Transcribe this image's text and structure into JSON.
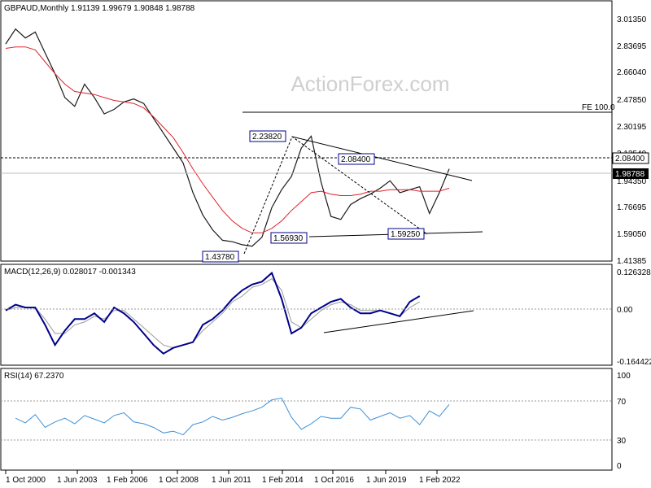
{
  "chart_data": [
    {
      "panel": "price",
      "type": "line",
      "title": "GBPAUD,Monthly 1.91139 1.99679 1.90848 1.98788",
      "watermark": "ActionForex.com",
      "symbol": "GBPAUD",
      "timeframe": "Monthly",
      "ohlc_last": {
        "open": 1.91139,
        "high": 1.99679,
        "low": 1.90848,
        "close": 1.98788
      },
      "current_price_label": "1.98788",
      "ylim": [
        1.36,
        3.11
      ],
      "y_ticks": [
        "3.01350",
        "2.83695",
        "2.66040",
        "2.47850",
        "2.30195",
        "2.12540",
        "1.94350",
        "1.76695",
        "1.59050",
        "1.41385"
      ],
      "x": [
        "2000-10",
        "2001-04",
        "2001-10",
        "2002-04",
        "2002-10",
        "2003-04",
        "2003-10",
        "2004-04",
        "2004-10",
        "2005-04",
        "2005-10",
        "2006-04",
        "2006-10",
        "2007-04",
        "2007-10",
        "2008-04",
        "2008-10",
        "2009-04",
        "2009-10",
        "2010-04",
        "2010-10",
        "2011-04",
        "2011-10",
        "2012-04",
        "2012-10",
        "2013-04",
        "2013-10",
        "2014-04",
        "2014-10",
        "2015-04",
        "2015-10",
        "2016-04",
        "2016-10",
        "2017-04",
        "2017-10",
        "2018-04",
        "2018-10",
        "2019-04",
        "2019-10",
        "2020-04",
        "2020-10",
        "2021-04",
        "2021-10",
        "2022-04",
        "2022-10",
        "2023-04"
      ],
      "series": [
        {
          "values": [
            2.82,
            2.92,
            2.86,
            2.9,
            2.76,
            2.62,
            2.46,
            2.4,
            2.55,
            2.46,
            2.35,
            2.38,
            2.43,
            2.45,
            2.42,
            2.32,
            2.22,
            2.12,
            2.02,
            1.82,
            1.67,
            1.57,
            1.5,
            1.49,
            1.47,
            1.46,
            1.52,
            1.72,
            1.84,
            1.93,
            2.12,
            2.2,
            1.89,
            1.66,
            1.64,
            1.74,
            1.78,
            1.81,
            1.85,
            1.9,
            1.82,
            1.84,
            1.86,
            1.68,
            1.82,
            1.98
          ]
        },
        {
          "name": "MA",
          "values": [
            2.79,
            2.8,
            2.8,
            2.78,
            2.7,
            2.62,
            2.55,
            2.5,
            2.49,
            2.48,
            2.46,
            2.44,
            2.43,
            2.42,
            2.39,
            2.33,
            2.26,
            2.19,
            2.09,
            1.98,
            1.88,
            1.79,
            1.7,
            1.63,
            1.58,
            1.55,
            1.55,
            1.58,
            1.63,
            1.7,
            1.76,
            1.82,
            1.83,
            1.81,
            1.8,
            1.8,
            1.81,
            1.83,
            1.83,
            1.84,
            1.84,
            1.84,
            1.83,
            1.83,
            1.83,
            1.85
          ]
        }
      ],
      "annotations": [
        "2.23820",
        "2.08400",
        "1.56930",
        "1.59250",
        "1.43780",
        "FE 100.0",
        "2.08400"
      ],
      "pivots": [
        {
          "label": "1.43780",
          "x": "2011-06",
          "y": 1.4378
        },
        {
          "label": "2.23820",
          "x": "2014-01",
          "y": 2.2382
        },
        {
          "label": "1.56930",
          "x": "2016-10",
          "y": 1.5693
        },
        {
          "label": "2.08400",
          "x": "2018-06",
          "y": 2.084
        },
        {
          "label": "1.59250",
          "x": "2022-09",
          "y": 1.5925
        }
      ],
      "fe_level": {
        "label": "FE 100.0",
        "y": 2.4
      }
    },
    {
      "panel": "macd",
      "type": "line",
      "title": "MACD(12,26,9) 0.028017 -0.001343",
      "ylim": [
        -0.2,
        0.15
      ],
      "y_ticks": [
        "0.126328",
        "0.00",
        "-0.164422"
      ],
      "x": [
        "2000-10",
        "2001-04",
        "2001-10",
        "2002-04",
        "2002-10",
        "2003-04",
        "2003-10",
        "2004-04",
        "2004-10",
        "2005-04",
        "2005-10",
        "2006-04",
        "2006-10",
        "2007-04",
        "2007-10",
        "2008-04",
        "2008-10",
        "2009-04",
        "2009-10",
        "2010-04",
        "2010-10",
        "2011-04",
        "2011-10",
        "2012-04",
        "2012-10",
        "2013-04",
        "2013-10",
        "2014-04",
        "2014-10",
        "2015-04",
        "2015-10",
        "2016-04",
        "2016-10",
        "2017-04",
        "2017-10",
        "2018-04",
        "2018-10",
        "2019-04",
        "2019-10",
        "2020-04",
        "2020-10",
        "2021-04",
        "2021-10",
        "2022-04",
        "2022-10",
        "2023-04"
      ],
      "series": [
        {
          "values": [
            -0.01,
            0.01,
            0.0,
            0.0,
            -0.06,
            -0.13,
            -0.08,
            -0.04,
            -0.04,
            -0.02,
            -0.05,
            0.0,
            -0.02,
            -0.05,
            -0.09,
            -0.13,
            -0.16,
            -0.14,
            -0.13,
            -0.12,
            -0.06,
            -0.04,
            -0.01,
            0.03,
            0.06,
            0.08,
            0.09,
            0.12,
            0.03,
            -0.09,
            -0.07,
            -0.02,
            0.0,
            0.02,
            0.03,
            0.0,
            -0.02,
            -0.02,
            -0.01,
            -0.02,
            -0.03,
            0.02,
            0.04
          ]
        },
        {
          "values": [
            -0.01,
            0.0,
            0.0,
            0.0,
            -0.04,
            -0.09,
            -0.09,
            -0.06,
            -0.05,
            -0.03,
            -0.04,
            -0.01,
            -0.01,
            -0.04,
            -0.07,
            -0.1,
            -0.13,
            -0.14,
            -0.13,
            -0.12,
            -0.08,
            -0.05,
            -0.02,
            0.02,
            0.04,
            0.07,
            0.08,
            0.1,
            0.06,
            -0.05,
            -0.07,
            -0.04,
            -0.01,
            0.01,
            0.02,
            0.01,
            -0.01,
            -0.01,
            -0.01,
            -0.02,
            -0.03,
            0.0,
            0.02
          ]
        }
      ]
    },
    {
      "panel": "rsi",
      "type": "line",
      "title": "RSI(14) 67.2370",
      "ylim": [
        0,
        100
      ],
      "y_ticks": [
        "100",
        "70",
        "30",
        "0"
      ],
      "x": [
        "2001-04",
        "2001-10",
        "2002-04",
        "2002-10",
        "2003-04",
        "2003-10",
        "2004-04",
        "2004-10",
        "2005-04",
        "2005-10",
        "2006-04",
        "2006-10",
        "2007-04",
        "2007-10",
        "2008-04",
        "2008-10",
        "2009-04",
        "2009-10",
        "2010-04",
        "2010-10",
        "2011-04",
        "2011-10",
        "2012-04",
        "2012-10",
        "2013-04",
        "2013-10",
        "2014-04",
        "2014-10",
        "2015-04",
        "2015-10",
        "2016-04",
        "2016-10",
        "2017-04",
        "2017-10",
        "2018-04",
        "2018-10",
        "2019-04",
        "2019-10",
        "2020-04",
        "2020-10",
        "2021-04",
        "2021-10",
        "2022-04",
        "2022-10",
        "2023-04"
      ],
      "series": [
        {
          "values": [
            52,
            47,
            56,
            42,
            48,
            52,
            46,
            55,
            51,
            47,
            55,
            58,
            48,
            46,
            42,
            36,
            38,
            34,
            45,
            48,
            54,
            50,
            53,
            57,
            60,
            64,
            72,
            74,
            53,
            40,
            46,
            54,
            52,
            52,
            64,
            62,
            50,
            54,
            58,
            52,
            55,
            45,
            60,
            54,
            67
          ]
        }
      ]
    }
  ],
  "x_tick_labels": [
    "1 Oct 2000",
    "1 Jun 2003",
    "1 Feb 2006",
    "1 Oct 2008",
    "1 Jun 2011",
    "1 Feb 2014",
    "1 Oct 2016",
    "1 Jun 2019",
    "1 Feb 2022"
  ],
  "colors": {
    "price": "#1a1a1a",
    "ma": "#e0202a",
    "macd": "#00008b",
    "signal": "#999999",
    "rsi": "#3d8fd6",
    "label_border": "#00008b"
  }
}
